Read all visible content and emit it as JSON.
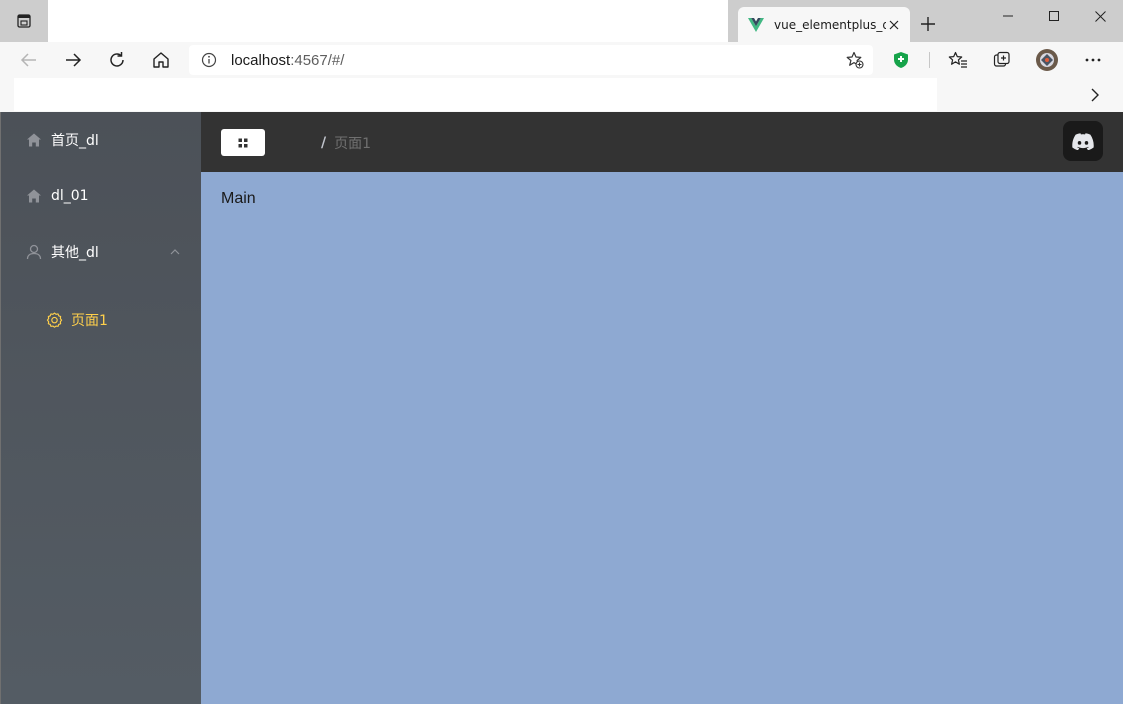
{
  "browser": {
    "tab": {
      "title": "vue_elementplus_dl",
      "favicon": "vue-logo-icon"
    },
    "address": {
      "host": "localhost",
      "path": ":4567/#/"
    },
    "window_controls": [
      "minimize-icon",
      "maximize-icon",
      "close-icon"
    ]
  },
  "sidebar": {
    "items": [
      {
        "label": "首页_dl",
        "icon": "home-icon"
      },
      {
        "label": "dl_01",
        "icon": "home-icon"
      },
      {
        "label": "其他_dl",
        "icon": "user-icon",
        "expanded": true
      }
    ],
    "submenu": [
      {
        "label": "页面1",
        "icon": "gear-icon",
        "active": true
      }
    ],
    "active_color": "#ffd04b"
  },
  "header": {
    "breadcrumb": {
      "separator": "/",
      "current": "页面1"
    },
    "avatar": "discord-icon"
  },
  "main": {
    "text": "Main"
  },
  "colors": {
    "sidebar_bg": "#545c64",
    "header_bg": "#333333",
    "main_bg": "#8ea9d2"
  }
}
